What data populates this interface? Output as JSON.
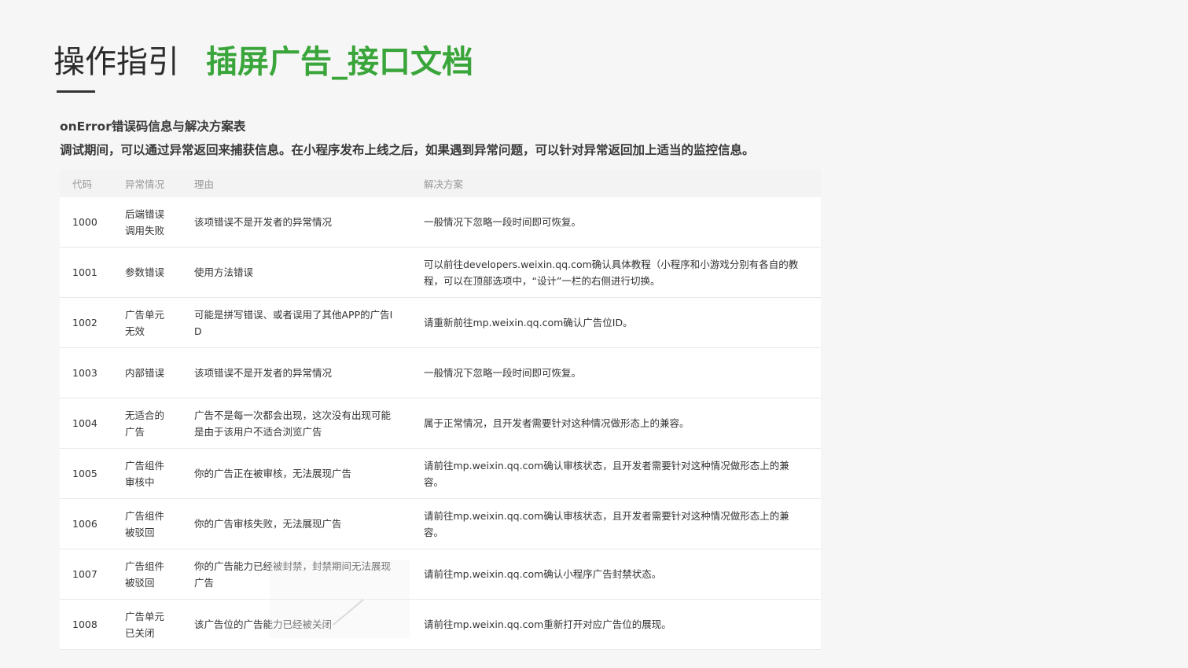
{
  "header": {
    "title": "操作指引",
    "subtitle": "插屏广告_接口文档"
  },
  "description": {
    "line1": "onError错误码信息与解决方案表",
    "line2": "调试期间，可以通过异常返回来捕获信息。在小程序发布上线之后，如果遇到异常问题，可以针对异常返回加上适当的监控信息。"
  },
  "table": {
    "headers": {
      "code": "代码",
      "situation": "异常情况",
      "reason": "理由",
      "solution": "解决方案"
    },
    "rows": [
      {
        "code": "1000",
        "situation": "后端错误调用失败",
        "reason": "该项错误不是开发者的异常情况",
        "solution": "一般情况下忽略一段时间即可恢复。"
      },
      {
        "code": "1001",
        "situation": "参数错误",
        "reason": "使用方法错误",
        "solution": "可以前往developers.weixin.qq.com确认具体教程（小程序和小游戏分别有各自的教程，可以在顶部选项中，“设计”一栏的右侧进行切换。"
      },
      {
        "code": "1002",
        "situation": "广告单元无效",
        "reason": "可能是拼写错误、或者误用了其他APP的广告ID",
        "solution": "请重新前往mp.weixin.qq.com确认广告位ID。"
      },
      {
        "code": "1003",
        "situation": "内部错误",
        "reason": "该项错误不是开发者的异常情况",
        "solution": "一般情况下忽略一段时间即可恢复。"
      },
      {
        "code": "1004",
        "situation": "无适合的广告",
        "reason": "广告不是每一次都会出现，这次没有出现可能是由于该用户不适合浏览广告",
        "solution": "属于正常情况，且开发者需要针对这种情况做形态上的兼容。"
      },
      {
        "code": "1005",
        "situation": "广告组件审核中",
        "reason": "你的广告正在被审核，无法展现广告",
        "solution": "请前往mp.weixin.qq.com确认审核状态，且开发者需要针对这种情况做形态上的兼容。"
      },
      {
        "code": "1006",
        "situation": "广告组件被驳回",
        "reason": "你的广告审核失败，无法展现广告",
        "solution": "请前往mp.weixin.qq.com确认审核状态，且开发者需要针对这种情况做形态上的兼容。"
      },
      {
        "code": "1007",
        "situation": "广告组件被驳回",
        "reason": "你的广告能力已经被封禁，封禁期间无法展现广告",
        "solution": "请前往mp.weixin.qq.com确认小程序广告封禁状态。"
      },
      {
        "code": "1008",
        "situation": "广告单元已关闭",
        "reason": "该广告位的广告能力已经被关闭",
        "solution": "请前往mp.weixin.qq.com重新打开对应广告位的展现。"
      }
    ]
  }
}
